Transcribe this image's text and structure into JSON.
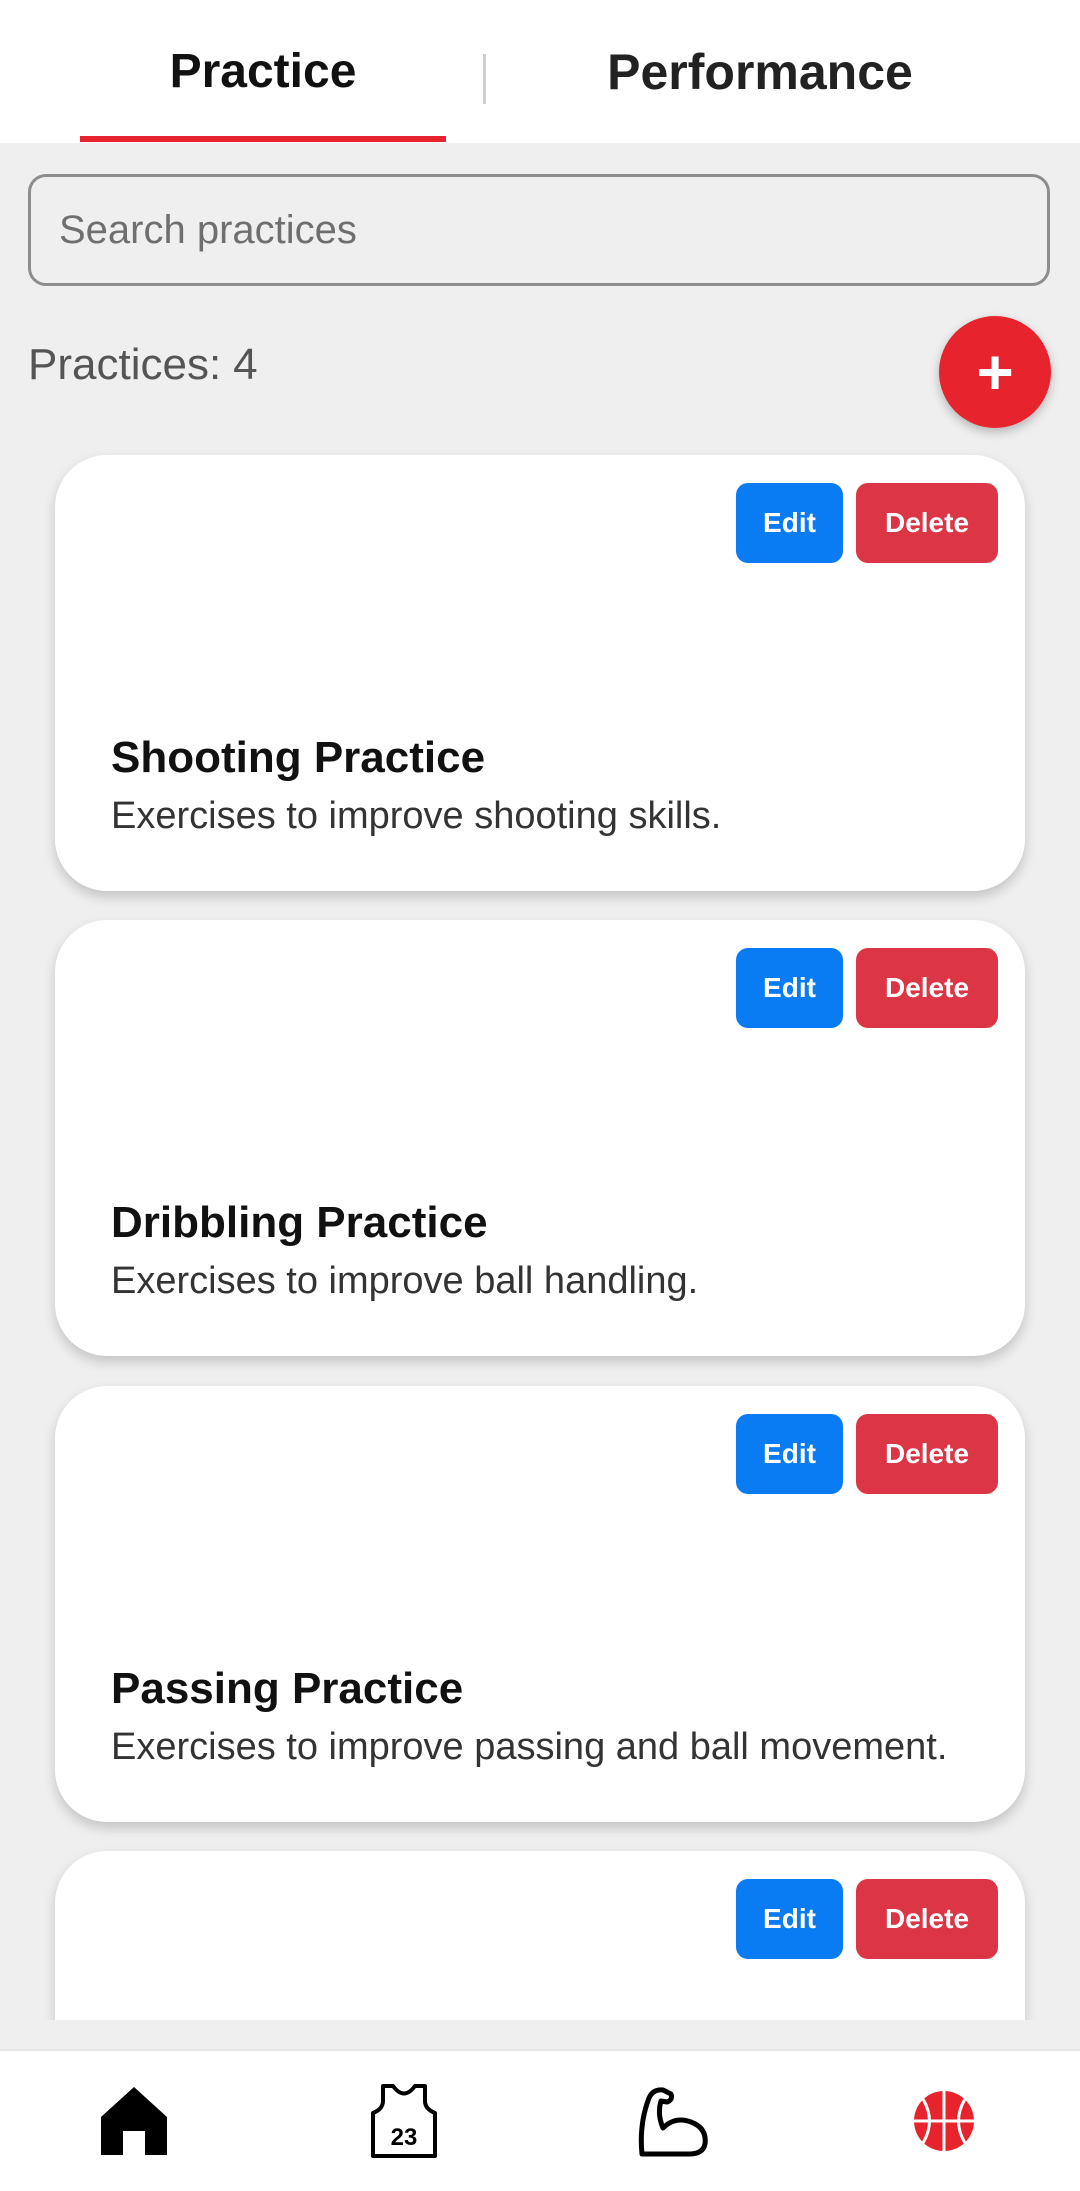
{
  "tabs": {
    "practice": "Practice",
    "performance": "Performance"
  },
  "search": {
    "placeholder": "Search practices",
    "value": ""
  },
  "summary": {
    "label": "Practices:",
    "count": "4"
  },
  "add_button": {
    "label": "+"
  },
  "cards": [
    {
      "edit": "Edit",
      "delete": "Delete",
      "title": "Shooting Practice",
      "description": "Exercises to improve shooting skills."
    },
    {
      "edit": "Edit",
      "delete": "Delete",
      "title": "Dribbling Practice",
      "description": "Exercises to improve ball handling."
    },
    {
      "edit": "Edit",
      "delete": "Delete",
      "title": "Passing Practice",
      "description": "Exercises to improve passing and ball movement."
    },
    {
      "edit": "Edit",
      "delete": "Delete",
      "title": "",
      "description": ""
    }
  ],
  "bottom_nav": {
    "items": [
      {
        "icon": "home-icon"
      },
      {
        "icon": "jersey-icon",
        "number": "23"
      },
      {
        "icon": "muscle-arm-icon"
      },
      {
        "icon": "basketball-icon"
      }
    ]
  },
  "colors": {
    "accent": "#e7232d",
    "edit": "#0a7cf3",
    "delete": "#dc3545",
    "background": "#efefef"
  }
}
